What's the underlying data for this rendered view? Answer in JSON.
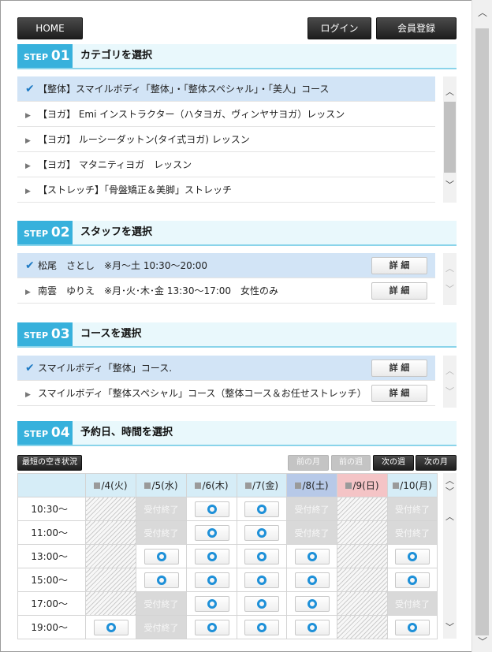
{
  "header": {
    "home_label": "HOME",
    "login_label": "ログイン",
    "register_label": "会員登録"
  },
  "steps": [
    {
      "label": "STEP",
      "num": "01",
      "title": "カテゴリを選択"
    },
    {
      "label": "STEP",
      "num": "02",
      "title": "スタッフを選択"
    },
    {
      "label": "STEP",
      "num": "03",
      "title": "コースを選択"
    },
    {
      "label": "STEP",
      "num": "04",
      "title": "予約日、時間を選択"
    }
  ],
  "categories": [
    {
      "label": "【整体】スマイルボディ「整体」・「整体スペシャル」・「美人」コース",
      "selected": true
    },
    {
      "label": "【ヨガ】 Emi インストラクター（ハタヨガ、ヴィンヤサヨガ）レッスン",
      "selected": false
    },
    {
      "label": "【ヨガ】 ルーシーダットン(タイ式ヨガ) レッスン",
      "selected": false
    },
    {
      "label": "【ヨガ】 マタニティヨガ　レッスン",
      "selected": false
    },
    {
      "label": "【ストレッチ】「骨盤矯正＆美脚」ストレッチ",
      "selected": false
    }
  ],
  "staff": [
    {
      "label": "松尾　さとし　※月～土 10:30～20:00",
      "selected": true,
      "detail": "詳 細"
    },
    {
      "label": "南雲　ゆりえ　※月･火･木･金 13:30～17:00　女性のみ",
      "selected": false,
      "detail": "詳 細"
    }
  ],
  "courses": [
    {
      "label": "スマイルボディ「整体」コース.",
      "selected": true,
      "detail": "詳 細"
    },
    {
      "label": "スマイルボディ「整体スペシャル」コース（整体コース＆お任せストレッチ）",
      "selected": false,
      "detail": "詳 細"
    }
  ],
  "calendar": {
    "nearest_label": "最短の空き状況",
    "prev_month": "前の月",
    "prev_week": "前の週",
    "next_week": "次の週",
    "next_month": "次の月",
    "days": [
      {
        "label": "/4(火)",
        "kind": "weekday"
      },
      {
        "label": "/5(水)",
        "kind": "weekday"
      },
      {
        "label": "/6(木)",
        "kind": "weekday"
      },
      {
        "label": "/7(金)",
        "kind": "weekday"
      },
      {
        "label": "/8(土)",
        "kind": "sat"
      },
      {
        "label": "/9(日)",
        "kind": "sun"
      },
      {
        "label": "/10(月)",
        "kind": "weekday"
      }
    ],
    "closed_label": "受付終了",
    "rows": [
      {
        "time": "10:30～",
        "cells": [
          "x",
          "c",
          "o",
          "o",
          "c",
          "x",
          "c"
        ]
      },
      {
        "time": "11:00～",
        "cells": [
          "x",
          "c",
          "o",
          "o",
          "c",
          "x",
          "c"
        ]
      },
      {
        "time": "13:00～",
        "cells": [
          "x",
          "o",
          "o",
          "o",
          "o",
          "x",
          "o"
        ]
      },
      {
        "time": "15:00～",
        "cells": [
          "x",
          "o",
          "o",
          "o",
          "o",
          "x",
          "o"
        ]
      },
      {
        "time": "17:00～",
        "cells": [
          "x",
          "c",
          "o",
          "o",
          "o",
          "x",
          "c"
        ]
      },
      {
        "time": "19:00～",
        "cells": [
          "o",
          "c",
          "o",
          "o",
          "o",
          "x",
          "o"
        ]
      }
    ]
  },
  "colors": {
    "step_badge": "#37b1dc",
    "selected_row": "#d2e4f6",
    "available_mark": "#1e90d8",
    "saturday": "#b7c9e8",
    "sunday": "#f4c4c6"
  },
  "icons": {
    "selected": "check-icon",
    "unselected": "triangle-right-icon",
    "available": "circle-icon"
  }
}
